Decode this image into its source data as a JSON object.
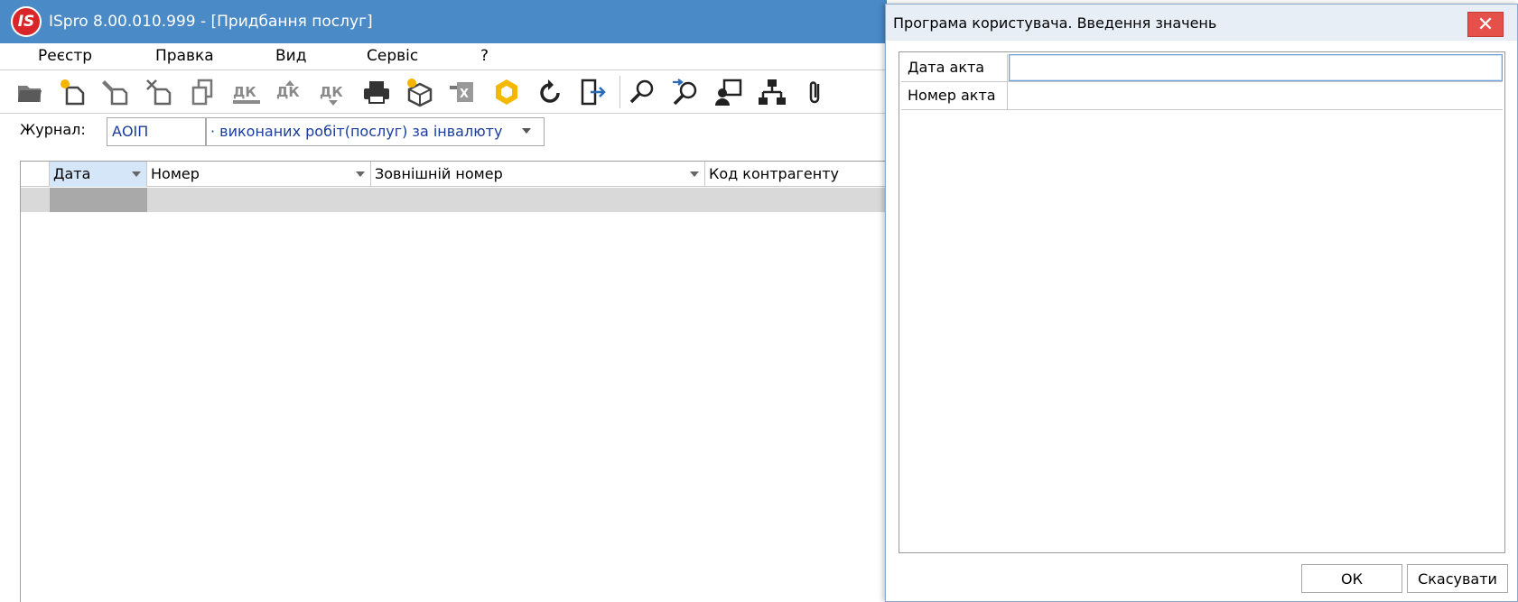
{
  "main": {
    "title": "ISpro 8.00.010.999 - [Придбання послуг]",
    "logo_text": "IS",
    "menu": [
      "Реєстр",
      "Правка",
      "Вид",
      "Сервіс",
      "?"
    ],
    "toolbar_icons": [
      "open-folder-icon",
      "new-document-icon",
      "edit-icon",
      "delete-icon",
      "copy-icon",
      "accounting-entry-icon",
      "accounting-entry-icon",
      "accounting-entry-icon",
      "print-icon",
      "package-icon",
      "excel-export-icon",
      "hexagon-icon",
      "refresh-icon",
      "exit-icon",
      "search-icon",
      "search-next-icon",
      "user-group-icon",
      "hierarchy-icon",
      "attachment-icon"
    ],
    "journal": {
      "label": "Журнал:",
      "code": "АОІП",
      "name": "· виконаних робіт(послуг) за інвалюту"
    },
    "grid": {
      "columns": [
        "Дата",
        "Номер",
        "Зовнішній номер",
        "Код контрагенту"
      ]
    }
  },
  "dialog": {
    "title": "Програма користувача. Введення значень",
    "close_glyph": "✕",
    "fields": [
      {
        "label": "Дата акта",
        "value": ""
      },
      {
        "label": "Номер акта",
        "value": ""
      }
    ],
    "ok_label": "ОК",
    "cancel_label": "Скасувати"
  },
  "colors": {
    "title_bar": "#4a8ac6",
    "close_button": "#e6504a",
    "journal_text": "#1a3d9c",
    "active_column": "#d4e6f7"
  }
}
